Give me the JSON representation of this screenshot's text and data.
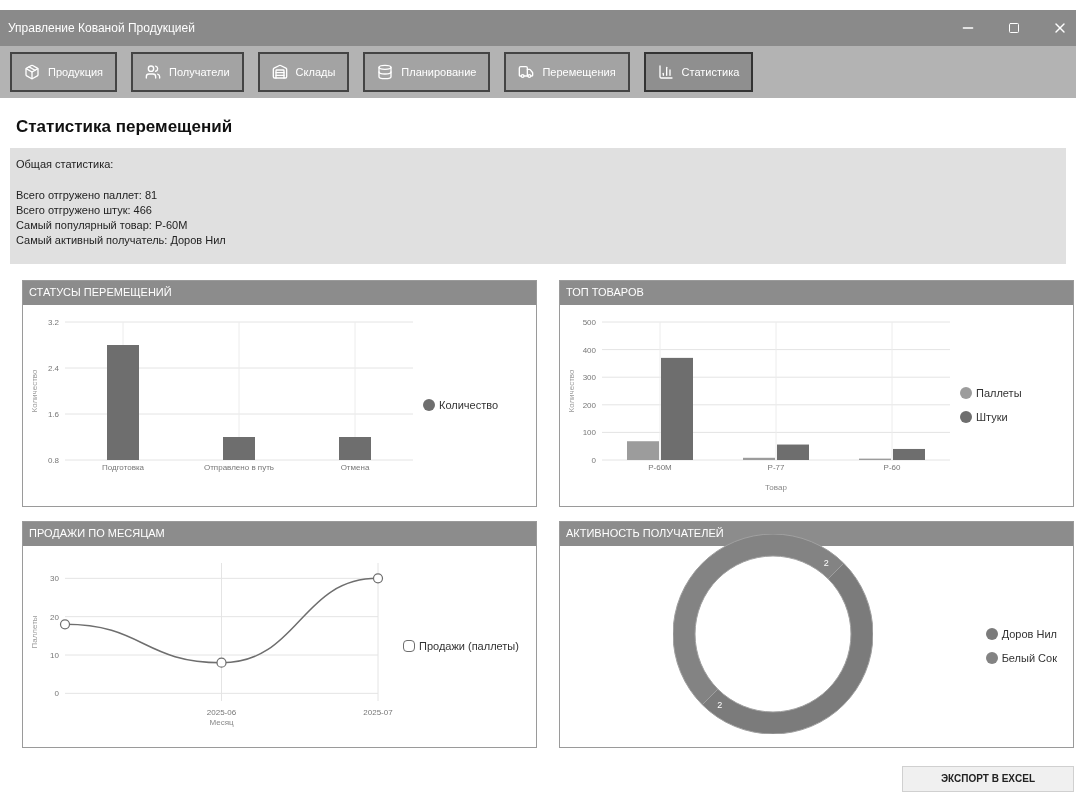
{
  "window": {
    "title": "Управление Кованой Продукцией"
  },
  "nav": [
    {
      "label": "Продукция",
      "selected": false
    },
    {
      "label": "Получатели",
      "selected": false
    },
    {
      "label": "Склады",
      "selected": false
    },
    {
      "label": "Планирование",
      "selected": false
    },
    {
      "label": "Перемещения",
      "selected": false
    },
    {
      "label": "Статистика",
      "selected": true
    }
  ],
  "heading": "Статистика перемещений",
  "summary": {
    "title": "Общая статистика:",
    "lines": [
      "Всего отгружено паллет: 81",
      "Всего отгружено штук: 466",
      "Самый популярный товар: Р-60М",
      "Самый активный получатель: Доров Нил"
    ]
  },
  "panels": [
    {
      "title": "СТАТУСЫ ПЕРЕМЕЩЕНИЙ",
      "chart_data": {
        "type": "bar",
        "ylabel": "Количество",
        "categories": [
          "Подготовка",
          "Отправлено в путь",
          "Отмена"
        ],
        "series": [
          {
            "name": "Количество",
            "color": "#6e6e6e",
            "values": [
              2.8,
              1.2,
              1.2
            ]
          }
        ],
        "ylim": [
          0.8,
          3.2
        ],
        "yticks": [
          0.8,
          1.6,
          2.4,
          3.2
        ],
        "grid": true,
        "legend": "right"
      }
    },
    {
      "title": "ТОП ТОВАРОВ",
      "chart_data": {
        "type": "bar",
        "xlabel": "Товар",
        "ylabel": "Количество",
        "categories": [
          "Р-60М",
          "Р-77",
          "Р-60"
        ],
        "series": [
          {
            "name": "Паллеты",
            "color": "#9c9c9c",
            "values": [
              68,
              8,
              5
            ]
          },
          {
            "name": "Штуки",
            "color": "#6e6e6e",
            "values": [
              370,
              56,
              40
            ]
          }
        ],
        "ylim": [
          0,
          500
        ],
        "yticks": [
          0,
          100,
          200,
          300,
          400,
          500
        ],
        "grid": true,
        "legend": "right"
      }
    },
    {
      "title": "ПРОДАЖИ ПО МЕСЯЦАМ",
      "chart_data": {
        "type": "line",
        "xlabel": "Месяц",
        "ylabel": "Паллеты",
        "categories": [
          null,
          "2025-06",
          "2025-07"
        ],
        "series": [
          {
            "name": "Продажи (паллеты)",
            "color": "#6e6e6e",
            "marker": "circle",
            "values": [
              18,
              8,
              30
            ]
          }
        ],
        "ylim": [
          -2,
          34
        ],
        "yticks": [
          0,
          10,
          20,
          30
        ],
        "grid": true,
        "legend": "right"
      }
    },
    {
      "title": "АКТИВНОСТЬ ПОЛУЧАТЕЛЕЙ",
      "chart_data": {
        "type": "donut",
        "categories": [
          "Доров Нил",
          "Белый Сок"
        ],
        "values": [
          2,
          2
        ],
        "data_labels": true,
        "legend": "right"
      }
    }
  ],
  "export_button": "ЭКСПОРТ В EXCEL"
}
